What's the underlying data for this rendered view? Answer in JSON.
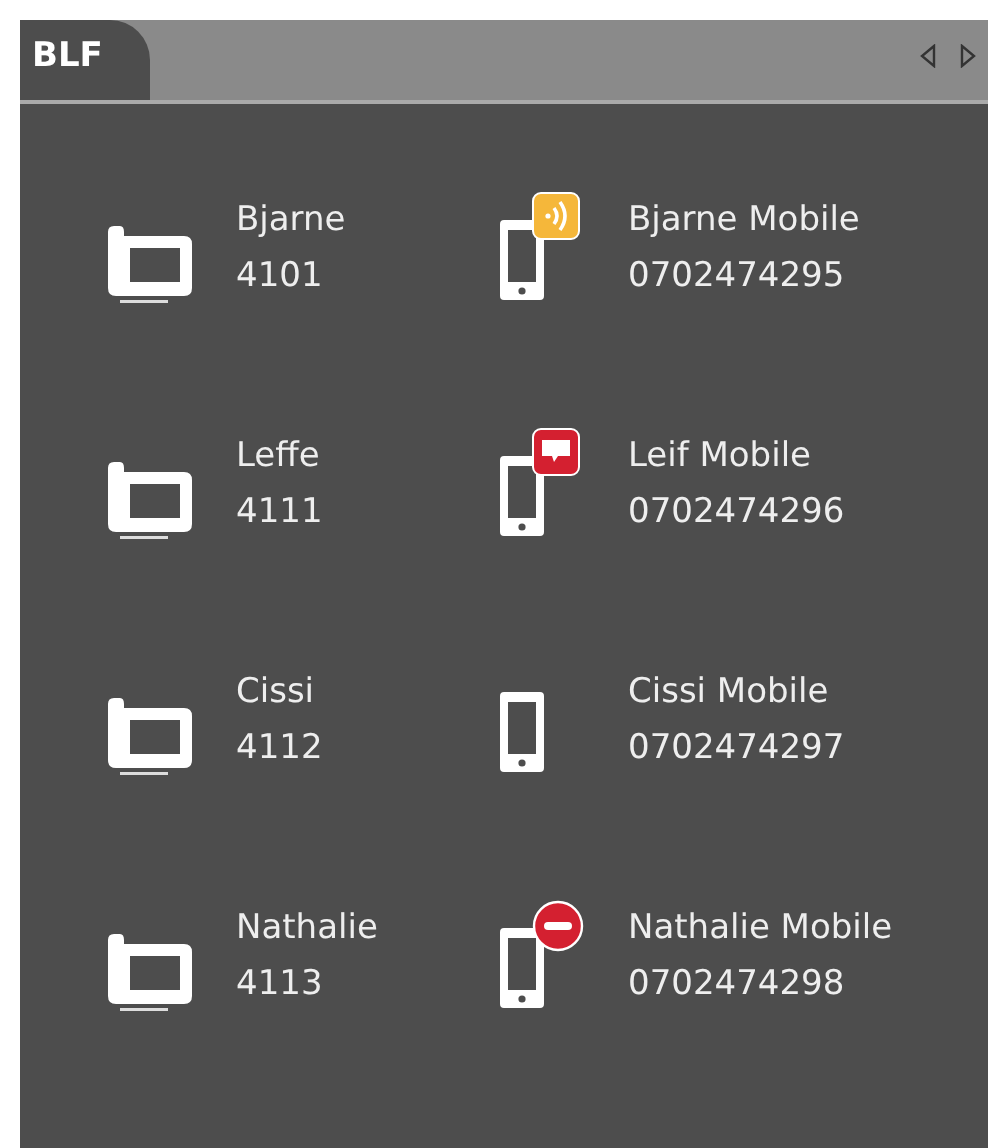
{
  "tab": {
    "label": "BLF",
    "selected": true
  },
  "rows": [
    [
      {
        "kind": "desk",
        "name": "Bjarne",
        "number": "4101"
      },
      {
        "kind": "mobile",
        "name": "Bjarne Mobile",
        "number": "0702474295",
        "badge": {
          "kind": "ringing"
        }
      }
    ],
    [
      {
        "kind": "desk",
        "name": "Leffe",
        "number": "4111"
      },
      {
        "kind": "mobile",
        "name": "Leif Mobile",
        "number": "0702474296",
        "badge": {
          "kind": "message"
        }
      }
    ],
    [
      {
        "kind": "desk",
        "name": "Cissi",
        "number": "4112"
      },
      {
        "kind": "mobile",
        "name": "Cissi Mobile",
        "number": "0702474297"
      }
    ],
    [
      {
        "kind": "desk",
        "name": "Nathalie",
        "number": "4113"
      },
      {
        "kind": "mobile",
        "name": "Nathalie Mobile",
        "number": "0702474298",
        "badge": {
          "kind": "busy"
        }
      }
    ]
  ]
}
